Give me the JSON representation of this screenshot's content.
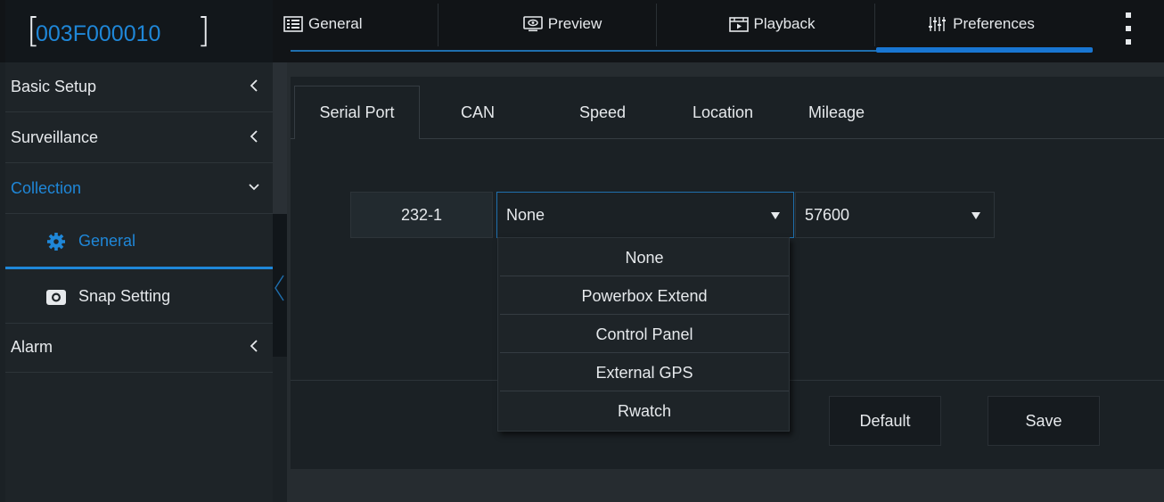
{
  "device": {
    "id": "003F000010"
  },
  "topnav": {
    "tabs": [
      {
        "label": "General",
        "icon": "list-icon"
      },
      {
        "label": "Preview",
        "icon": "preview-icon"
      },
      {
        "label": "Playback",
        "icon": "playback-icon"
      },
      {
        "label": "Preferences",
        "icon": "sliders-icon",
        "active": true
      }
    ]
  },
  "sidebar": {
    "items": [
      {
        "label": "Basic Setup"
      },
      {
        "label": "Surveillance"
      },
      {
        "label": "Collection",
        "expanded": true
      },
      {
        "label": "Alarm"
      }
    ],
    "subitems": [
      {
        "label": "General",
        "icon": "gear-icon",
        "active": true
      },
      {
        "label": "Snap Setting",
        "icon": "camera-icon"
      }
    ]
  },
  "subtabs": [
    {
      "label": "Serial Port",
      "active": true
    },
    {
      "label": "CAN"
    },
    {
      "label": "Speed"
    },
    {
      "label": "Location"
    },
    {
      "label": "Mileage"
    }
  ],
  "serial": {
    "port": "232-1",
    "device_value": "None",
    "baud_value": "57600",
    "options": [
      "None",
      "Powerbox Extend",
      "Control Panel",
      "External GPS",
      "Rwatch"
    ]
  },
  "buttons": {
    "default_label": "Default",
    "save_label": "Save"
  },
  "colors": {
    "accent": "#1f87d8",
    "background": "#1b2125",
    "topbar": "#111417"
  }
}
